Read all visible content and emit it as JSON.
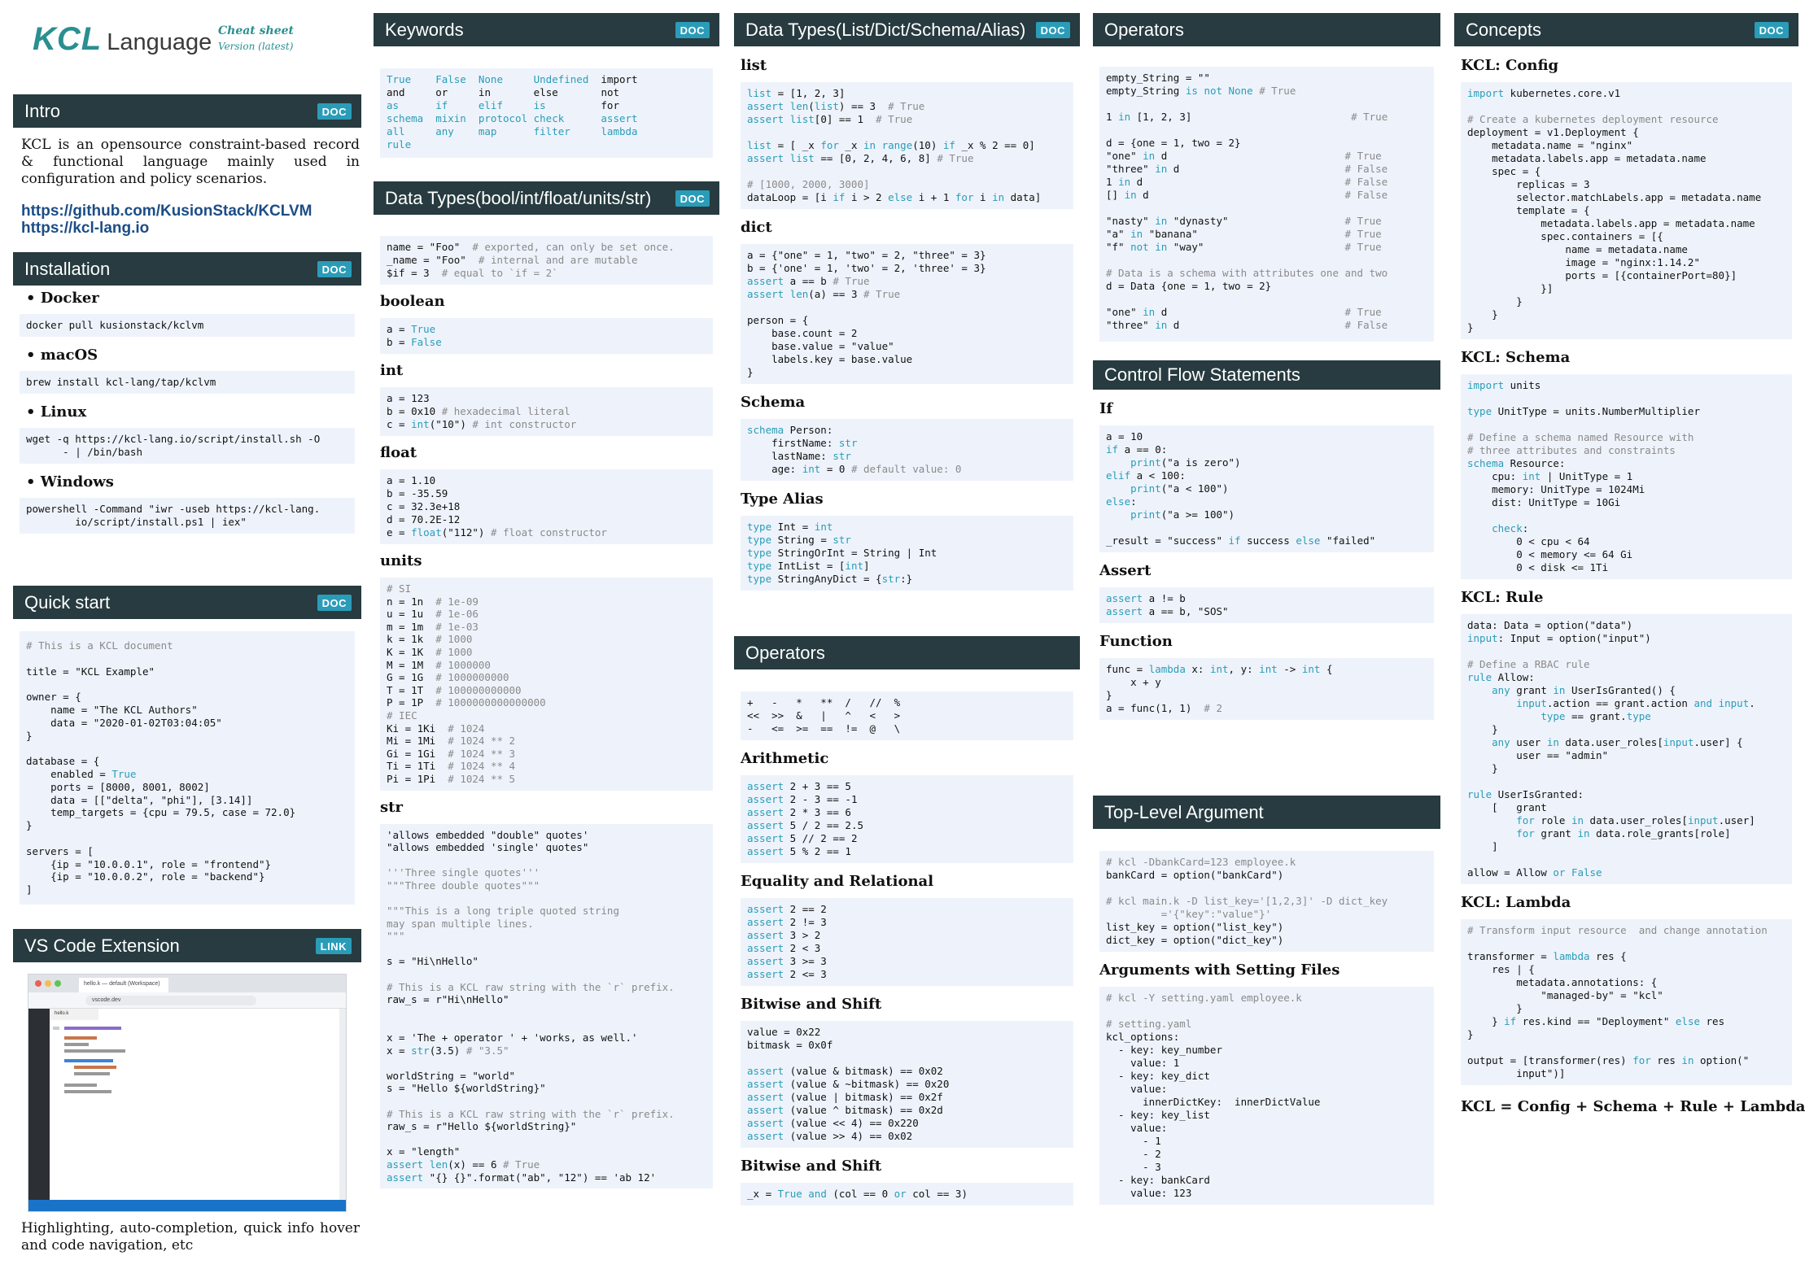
{
  "logo": {
    "kcl": "KCL",
    "language": "Language",
    "cheat_sheet": "Cheat sheet",
    "version": "Version (latest)"
  },
  "badges": {
    "doc": "DOC",
    "link": "LINK"
  },
  "intro": {
    "title": "Intro",
    "text": "KCL is an opensource constraint-based record & functional language mainly used in configuration and policy scenarios.",
    "link1": "https://github.com/KusionStack/KCLVM",
    "link2": "https://kcl-lang.io"
  },
  "installation": {
    "title": "Installation",
    "docker": "Docker",
    "docker_cmd": "docker pull kusionstack/kclvm",
    "macos": "macOS",
    "macos_cmd": "brew install kcl-lang/tap/kclvm",
    "linux": "Linux",
    "linux_cmd": "wget -q https://kcl-lang.io/script/install.sh -O\n      - | /bin/bash",
    "windows": "Windows",
    "windows_cmd": "powershell -Command \"iwr -useb https://kcl-lang.\n        io/script/install.ps1 | iex\""
  },
  "quickstart": {
    "title": "Quick start"
  },
  "vscode": {
    "title": "VS Code Extension",
    "tab": "hello.k — default (Workspace)",
    "url": "vscode.dev",
    "file": "hello.k",
    "caption": "Highlighting, auto-completion, quick info hover and code navigation, etc"
  },
  "keywords": {
    "title": "Keywords"
  },
  "datatypes1": {
    "title": "Data Types(bool/int/float/units/str)",
    "boolean": "boolean",
    "int": "int",
    "float": "float",
    "units": "units",
    "str": "str"
  },
  "datatypes2": {
    "title": "Data Types(List/Dict/Schema/Alias)",
    "list": "list",
    "dict": "dict",
    "schema": "Schema",
    "alias": "Type Alias"
  },
  "operators2": {
    "title": "Operators",
    "arith": "Arithmetic",
    "eq": "Equality and Relational",
    "bit1": "Bitwise and Shift",
    "bit2": "Bitwise and Shift"
  },
  "operators1": {
    "title": "Operators"
  },
  "control": {
    "title": "Control Flow Statements",
    "if": "If",
    "assert": "Assert",
    "function": "Function"
  },
  "toplevel": {
    "title": "Top-Level Argument",
    "setting": "Arguments with Setting Files"
  },
  "concepts": {
    "title": "Concepts",
    "config": "KCL: Config",
    "schema": "KCL: Schema",
    "rule": "KCL: Rule",
    "lambda": "KCL: Lambda",
    "formula": "KCL = Config + Schema + Rule + Lambda"
  }
}
